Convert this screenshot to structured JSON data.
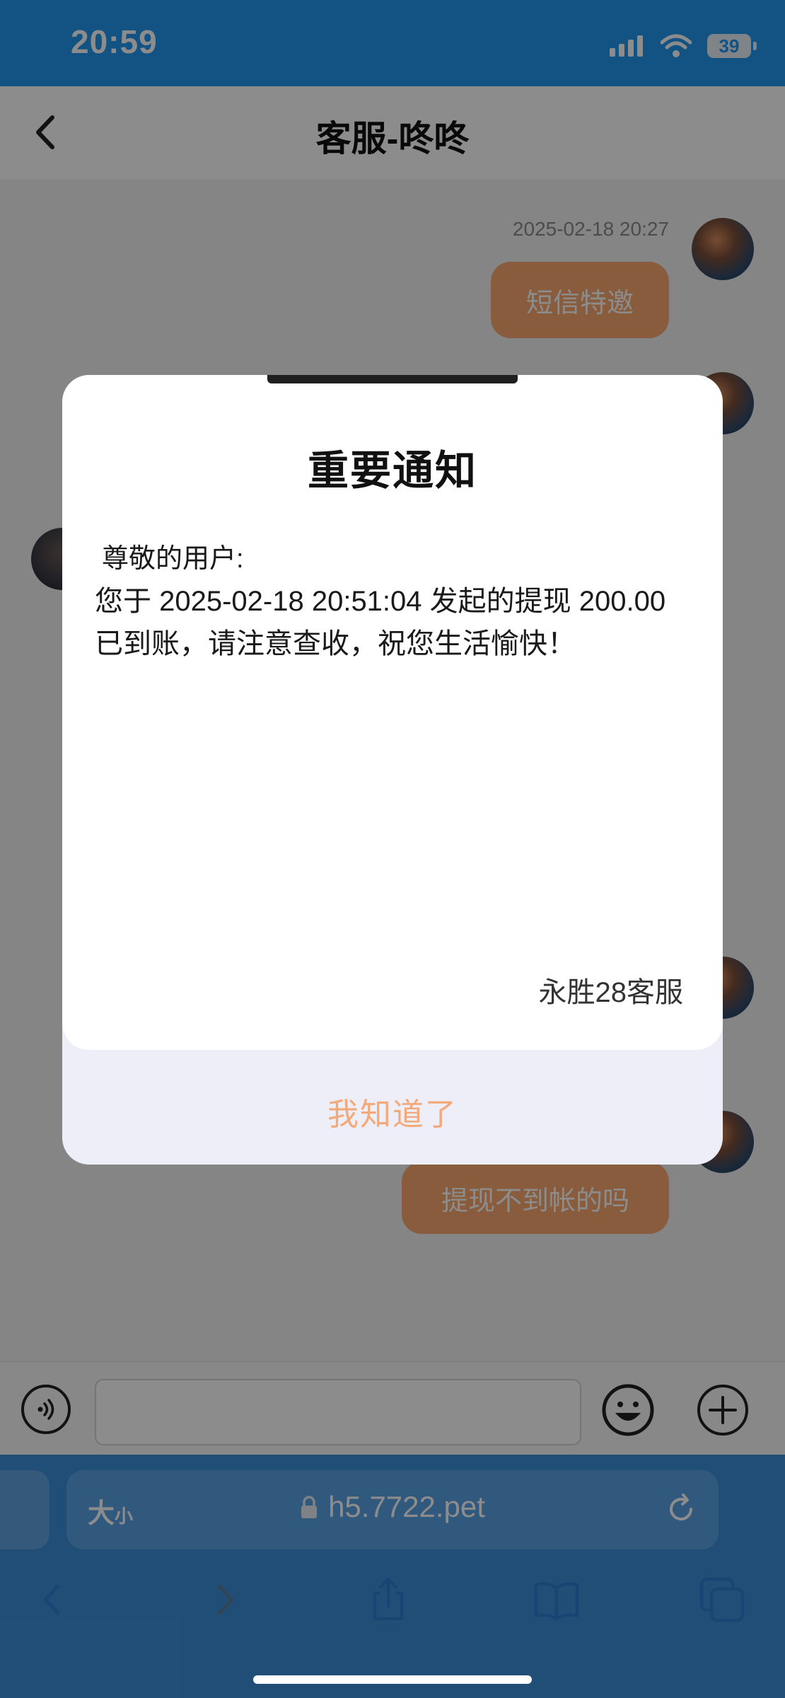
{
  "status_bar": {
    "time": "20:59",
    "battery": "39"
  },
  "header": {
    "title": "客服-咚咚"
  },
  "chat": {
    "messages": [
      {
        "timestamp": "2025-02-18 20:27",
        "text": "短信特邀"
      },
      {
        "text": "提现不到帐的吗"
      }
    ]
  },
  "dialog": {
    "title": "重要通知",
    "greeting": "尊敬的用户:",
    "body": "您于 2025-02-18 20:51:04 发起的提现 200.00 已到账，请注意查收，祝您生活愉快！",
    "signature": "永胜28客服",
    "confirm_label": "我知道了"
  },
  "browser": {
    "text_size_label_big": "大",
    "text_size_label_small": "小",
    "url": "h5.7722.pet"
  },
  "colors": {
    "status_bar": "#2297ef",
    "outgoing_bubble": "#f7a86e",
    "confirm_text": "#f4a97a",
    "safari_bar": "#3d8fd9"
  }
}
